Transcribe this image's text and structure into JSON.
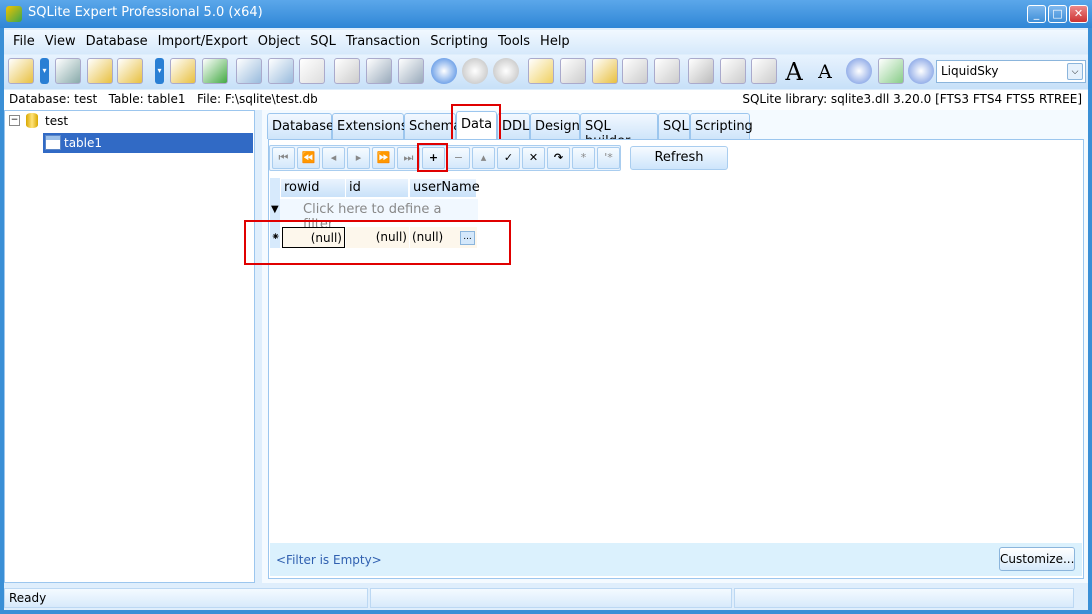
{
  "window": {
    "title": "SQLite Expert Professional 5.0 (x64)"
  },
  "menu": [
    "File",
    "View",
    "Database",
    "Import/Export",
    "Object",
    "SQL",
    "Transaction",
    "Scripting",
    "Tools",
    "Help"
  ],
  "toolbar": {
    "theme_value": "LiquidSky",
    "icons": [
      "new-database-icon",
      "dropdown-icon",
      "design-table-icon",
      "database-settings-icon",
      "save-database-icon",
      "dropdown-icon",
      "attach-database-icon",
      "import-table-icon",
      "new-table-icon",
      "edit-table-icon",
      "new-view-icon",
      "sql-editor-icon",
      "commit-icon",
      "execute-icon",
      "play-icon",
      "next-icon",
      "previous-icon",
      "script-icon",
      "script-edit-icon",
      "script-run-icon",
      "script-save-icon",
      "script-save-as-icon",
      "settings-icon",
      "copy-icon",
      "paste-icon",
      "font-increase-icon",
      "font-decrease-icon",
      "help-icon",
      "download-icon",
      "info-icon"
    ]
  },
  "infobar": {
    "left": "Database: test   Table: table1   File: F:\\sqlite\\test.db",
    "right": "SQLite library: sqlite3.dll 3.20.0 [FTS3 FTS4 FTS5 RTREE]"
  },
  "tree": {
    "database": "test",
    "table": "table1"
  },
  "tabs": [
    "Database",
    "Extensions",
    "Schema",
    "Data",
    "DDL",
    "Design",
    "SQL builder",
    "SQL",
    "Scripting"
  ],
  "active_tab": "Data",
  "nav": {
    "buttons": [
      "⏮",
      "⏪",
      "◂",
      "▸",
      "⏩",
      "⏭",
      "+",
      "−",
      "▴",
      "✓",
      "✕",
      "↷",
      "*",
      "'*"
    ],
    "refresh": "Refresh"
  },
  "grid": {
    "columns": [
      "rowid",
      "id",
      "userName"
    ],
    "filter_hint": "Click here to define a filter",
    "new_row": [
      "(null)",
      "(null)",
      "(null)"
    ],
    "ellipsis": "..."
  },
  "filter_bar": {
    "text": "<Filter is Empty>",
    "customize": "Customize..."
  },
  "status": {
    "text": "Ready"
  }
}
